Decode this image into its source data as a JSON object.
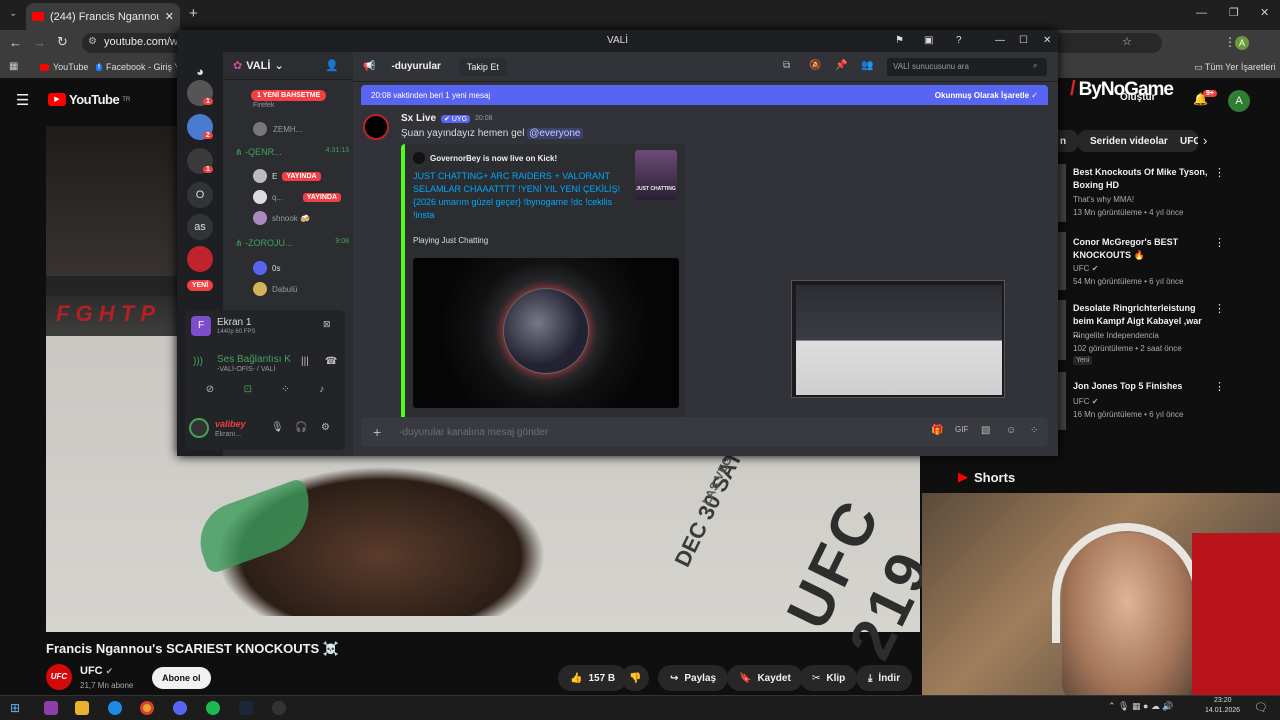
{
  "browser": {
    "tab_count": "(244)",
    "tab_title": "(244) Francis Ngannou's SCAR",
    "url": "youtube.com/wat",
    "profile": "A",
    "bookmarks": [
      "YouTube",
      "Facebook - Giriş Ya"
    ],
    "all_bookmarks": "Tüm Yer İşaretleri"
  },
  "youtube": {
    "logo": "YouTube",
    "logo_sup": "TR",
    "notif_count": "9+",
    "create_label": "Oluştur",
    "avatar": "A",
    "chips": [
      "n",
      "Seriden videolar",
      "UFC"
    ],
    "video_title": "Francis Ngannou's SCARIEST KNOCKOUTS ☠️",
    "channel_name": "UFC",
    "subscribers": "21,7 Mn abone",
    "subscribe_label": "Abone ol",
    "likes": "157 B",
    "share_label": "Paylaş",
    "save_label": "Kaydet",
    "clip_label": "Klip",
    "download_label": "İndir",
    "overlay_brand": "ByNoGame",
    "octagon_text": "UFC 219",
    "octagon_sub": "DEC 30 SAT",
    "octagon_place": "LAS VEGAS",
    "shorts_label": "Shorts",
    "recommendations": [
      {
        "title": "Best Knockouts Of Mike Tyson, Boxing HD",
        "channel": "That's why MMA!",
        "meta": "13 Mn görüntüleme • 4 yıl önce",
        "badge": ""
      },
      {
        "title": "Conor McGregor's BEST KNOCKOUTS 🔥",
        "channel": "UFC",
        "meta": "54 Mn görüntüleme • 6 yıl önce",
        "badge": ""
      },
      {
        "title": "Desolate Ringrichterleistung beim Kampf Aigt Kabayel ,war ...",
        "channel": "Ringelite Independencia",
        "meta": "102 görüntüleme • 2 saat önce",
        "badge": "Yeni"
      },
      {
        "title": "Jon Jones Top 5 Finishes",
        "channel": "UFC",
        "meta": "16 Mn görüntüleme • 6 yıl önce",
        "badge": ""
      }
    ]
  },
  "discord": {
    "window_title": "VALİ",
    "server_name": "VALİ",
    "mention_banner": "1 YENİ BAHSETME",
    "channel_name": "-duyurular",
    "follow_label": "Takip Et",
    "search_placeholder": "VALİ sunucusunu ara",
    "new_msg_banner": "20:08 vaktinden beri 1 yeni mesaj",
    "mark_read": "Okunmuş Olarak İşaretle",
    "server_letters": [
      "O",
      "as"
    ],
    "new_label": "YENİ",
    "voice_channels": [
      {
        "name": "-QENR...",
        "time": "4:31:13",
        "members": [
          {
            "name": "E",
            "live": "YAYINDA"
          },
          {
            "name": "q...",
            "live": "YAYINDA"
          },
          {
            "name": "shnook 🍻",
            "live": ""
          }
        ]
      },
      {
        "name": "-ZOROJU...",
        "time": "9:08",
        "members": [
          {
            "name": "0s",
            "live": ""
          },
          {
            "name": "Dabulü",
            "live": ""
          }
        ]
      }
    ],
    "top_members": [
      "Firefek",
      "ZEMH..."
    ],
    "stream_panel": {
      "title": "Ekran 1",
      "sub": "1440p 60 FPS"
    },
    "voice_status": {
      "title": "Ses Bağlantısı K",
      "sub": "-VALİ-OFİS- / VALİ"
    },
    "user": {
      "name": "valibey",
      "status": "Ekranı..."
    },
    "message": {
      "author": "Sx Live",
      "tag": "UYG",
      "time": "20:08",
      "text": "Şuan yayındayız hemen gel",
      "mention": "@everyone",
      "embed_author": "GovernorBey is now live on Kick!",
      "embed_title": "JUST CHATTING+ ARC RAIDERS + VALORANT SELAMLAR CHAAATTTT  !YENİ YIL YENİ ÇEKİLİŞ! {2026 umarım güzel geçer} !bynogame !dc !cekilis !insta",
      "embed_desc": "Playing Just Chatting",
      "thumb_text": "JUST CHATTING"
    },
    "composer_placeholder": "-duyurular kanalına mesaj gönder"
  },
  "taskbar": {
    "time": "23:20",
    "date": "14.01.2026"
  }
}
